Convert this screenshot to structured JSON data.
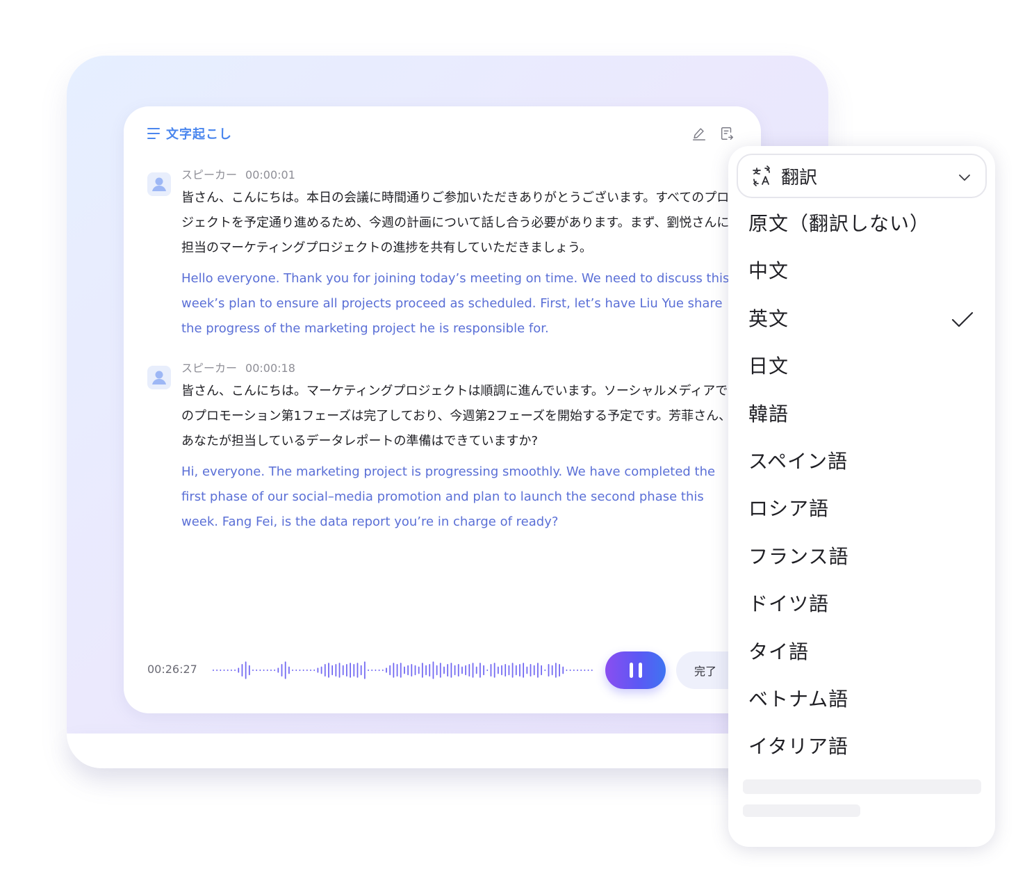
{
  "transcript": {
    "title": "文字起こし",
    "segments": [
      {
        "speaker": "スピーカー",
        "time": "00:00:01",
        "original": "皆さん、こんにちは。本日の会議に時間通りご参加いただきありがとうございます。すべてのプロジェクトを予定通り進めるため、今週の計画について話し合う必要があります。まず、劉悦さんに担当のマーケティングプロジェクトの進捗を共有していただきましょう。",
        "translation": "Hello everyone. Thank you for joining today’s meeting on time. We need to discuss this week’s plan to ensure all projects proceed as scheduled. First, let’s have Liu Yue share the progress of the marketing project he is responsible for."
      },
      {
        "speaker": "スピーカー",
        "time": "00:00:18",
        "original": "皆さん、こんにちは。マーケティングプロジェクトは順調に進んでいます。ソーシャルメディアでのプロモーション第1フェーズは完了しており、今週第2フェーズを開始する予定です。芳菲さん、あなたが担当しているデータレポートの準備はできていますか?",
        "translation": "Hi, everyone. The marketing project is progressing smoothly. We have completed the first phase of our social–media promotion and plan to launch the second phase this week. Fang Fei, is the data report you’re in charge of ready?"
      }
    ]
  },
  "player": {
    "elapsed": "00:26:27",
    "done_label": "完了"
  },
  "translate_menu": {
    "label": "翻訳",
    "selected": "英文",
    "options": [
      "原文（翻訳しない）",
      "中文",
      "英文",
      "日文",
      "韓語",
      "スペイン語",
      "ロシア語",
      "フランス語",
      "ドイツ語",
      "タイ語",
      "ベトナム語",
      "イタリア語"
    ]
  },
  "colors": {
    "accent": "#4a86ee",
    "translation_text": "#5a6fd6",
    "wave_start": "#8a7cf0",
    "wave_end": "#5c58f4"
  }
}
